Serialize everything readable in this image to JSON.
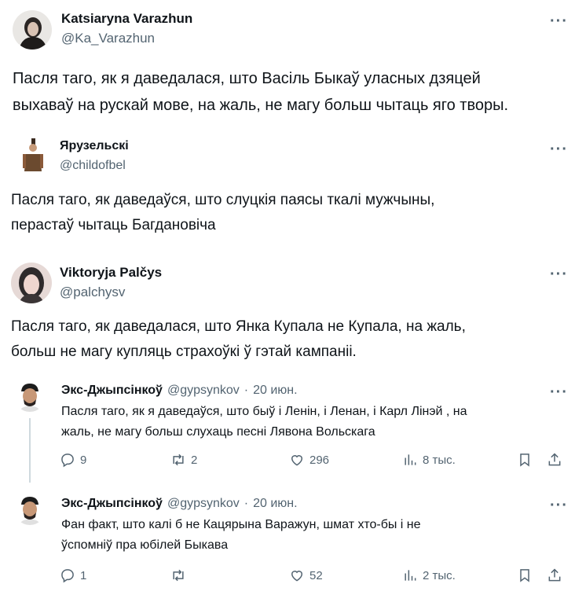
{
  "tweets": [
    {
      "name": "Katsiaryna Varazhun",
      "handle": "@Ka_Varazhun",
      "more": "···",
      "lines": [
        "Пасля таго, як я даведалася, што Васіль Быкаў уласных дзяцей",
        "выхаваў на рускай мове, на жаль, не магу больш чытаць яго творы."
      ]
    },
    {
      "name": "Ярузельскі",
      "handle": "@childofbel",
      "more": "···",
      "lines": [
        "Пасля таго, як даведаўся, што слуцкія паясы ткалі мужчыны,",
        "перастаў чытаць Багдановіча"
      ]
    },
    {
      "name": "Viktoryja Palčys",
      "handle": "@palchysv",
      "more": "···",
      "lines": [
        "Пасля таго, як даведалася, што Янка Купала не Купала, на жаль,",
        "больш не магу купляць страхоўкі ў гэтай кампаніі."
      ]
    }
  ],
  "replies": [
    {
      "name": "Экс-Джыпсінкоў",
      "handle": "@gypsynkov",
      "separator": "·",
      "date": "20 июн.",
      "more": "···",
      "lines": [
        "Пасля таго, як я даведаўся, што быў і Ленін,  і Ленан, і Карл Лінэй , на",
        "жаль, не магу больш слухаць песні Лявона Вольскага"
      ],
      "actions": {
        "replies": "9",
        "reposts": "2",
        "likes": "296",
        "views": "8 тыс."
      }
    },
    {
      "name": "Экс-Джыпсінкоў",
      "handle": "@gypsynkov",
      "separator": "·",
      "date": "20 июн.",
      "more": "···",
      "lines": [
        "Фан факт, што калі б не Кацярына Варажун, шмат хто-бы і не",
        "ўспомніў пра юбілей Быкава"
      ],
      "actions": {
        "replies": "1",
        "reposts": "",
        "likes": "52",
        "views": "2 тыс."
      }
    }
  ],
  "icons": [
    "reply-icon",
    "repost-icon",
    "like-icon",
    "views-icon",
    "bookmark-icon",
    "share-icon"
  ]
}
